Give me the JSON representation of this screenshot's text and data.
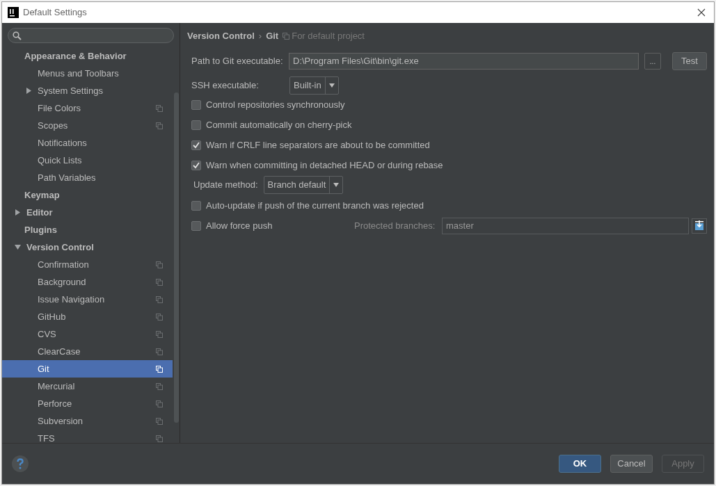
{
  "window": {
    "title": "Default Settings"
  },
  "tree": [
    {
      "label": "Appearance & Behavior",
      "selected": false,
      "children": [
        {
          "label": "Menus and Toolbars",
          "project_scoped": false,
          "selected": false
        },
        {
          "label": "System Settings",
          "expanded": false,
          "project_scoped": false,
          "selected": false
        },
        {
          "label": "File Colors",
          "project_scoped": true,
          "selected": false
        },
        {
          "label": "Scopes",
          "project_scoped": true,
          "selected": false
        },
        {
          "label": "Notifications",
          "project_scoped": false,
          "selected": false
        },
        {
          "label": "Quick Lists",
          "project_scoped": false,
          "selected": false
        },
        {
          "label": "Path Variables",
          "project_scoped": false,
          "selected": false
        }
      ]
    },
    {
      "label": "Keymap",
      "selected": false
    },
    {
      "label": "Editor",
      "expanded": false,
      "selected": false
    },
    {
      "label": "Plugins",
      "selected": false
    },
    {
      "label": "Version Control",
      "expanded": true,
      "selected": false,
      "children": [
        {
          "label": "Confirmation",
          "project_scoped": true,
          "selected": false
        },
        {
          "label": "Background",
          "project_scoped": true,
          "selected": false
        },
        {
          "label": "Issue Navigation",
          "project_scoped": true,
          "selected": false
        },
        {
          "label": "GitHub",
          "project_scoped": true,
          "selected": false
        },
        {
          "label": "CVS",
          "project_scoped": true,
          "selected": false
        },
        {
          "label": "ClearCase",
          "project_scoped": true,
          "selected": false
        },
        {
          "label": "Git",
          "project_scoped": true,
          "selected": true
        },
        {
          "label": "Mercurial",
          "project_scoped": true,
          "selected": false
        },
        {
          "label": "Perforce",
          "project_scoped": true,
          "selected": false
        },
        {
          "label": "Subversion",
          "project_scoped": true,
          "selected": false
        },
        {
          "label": "TFS",
          "project_scoped": true,
          "selected": false
        }
      ]
    }
  ],
  "breadcrumb": {
    "parent": "Version Control",
    "separator": "›",
    "current": "Git",
    "note": "For default project"
  },
  "path_row": {
    "label": "Path to Git executable:",
    "value": "D:\\Program Files\\Git\\bin\\git.exe",
    "browse": "...",
    "test": "Test"
  },
  "ssh_row": {
    "label": "SSH executable:",
    "value": "Built-in"
  },
  "options_top": [
    {
      "label": "Control repositories synchronously",
      "checked": false
    },
    {
      "label": "Commit automatically on cherry-pick",
      "checked": false
    },
    {
      "label": "Warn if CRLF line separators are about to be committed",
      "checked": true
    },
    {
      "label": "Warn when committing in detached HEAD or during rebase",
      "checked": true
    }
  ],
  "update_row": {
    "label": "Update method:",
    "value": "Branch default"
  },
  "options_bottom": [
    {
      "label": "Auto-update if push of the current branch was rejected",
      "checked": false
    }
  ],
  "force_push": {
    "label": "Allow force push",
    "checked": false,
    "protected_label": "Protected branches:",
    "protected_value": "master"
  },
  "buttons": [
    {
      "label": "OK",
      "kind": "default"
    },
    {
      "label": "Cancel",
      "kind": "normal"
    },
    {
      "label": "Apply",
      "kind": "disabled"
    }
  ]
}
